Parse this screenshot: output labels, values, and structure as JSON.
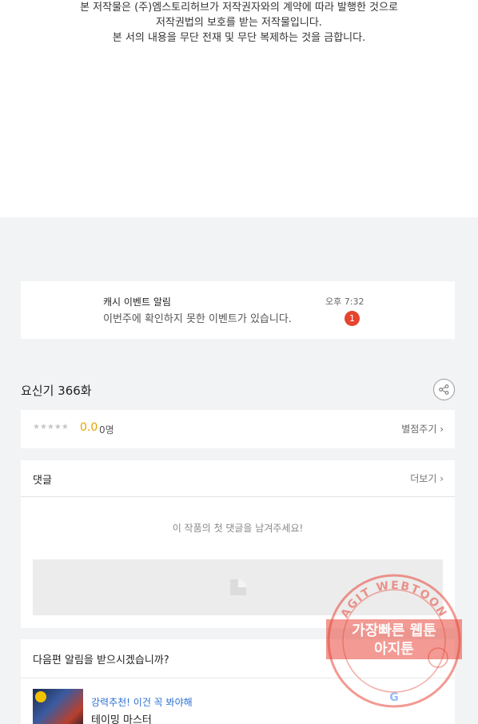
{
  "copyright": {
    "line1": "본 저작물은 (주)엠스토리허브가 저작권자와의 계약에 따라 발행한 것으로",
    "line2": "저작권법의 보호를 받는 저작물입니다.",
    "line3": "본 서의 내용을 무단 전재 및 무단 복제하는 것을 금합니다."
  },
  "notice": {
    "title": "캐시 이벤트 알림",
    "body": "이번주에 확인하지 못한 이벤트가 있습니다.",
    "time": "오후 7:32",
    "badge": "1"
  },
  "episode": {
    "title": "요신기 366화",
    "share_icon": "share-icon"
  },
  "rating": {
    "stars": "★★★★★",
    "score": "0.0",
    "count": "0명",
    "rate_label": "별점주기 ›"
  },
  "comments": {
    "title": "댓글",
    "more_label": "더보기 ›",
    "empty_text": "이 작품의 첫 댓글을 남겨주세요!"
  },
  "next_alert": {
    "title": "다음편 알림을 받으시겠습니까?",
    "rec_label": "강력추천! 이건 꼭 봐야해",
    "rec_title": "테이밍 마스터"
  },
  "watermark": {
    "arc_text": "AGIT WEBTOON",
    "line1": "가장빠른 웹툰",
    "line2": "아지툰"
  },
  "colors": {
    "badge": "#e5442f",
    "score": "#e6a100",
    "rec_label": "#2c6fd1",
    "watermark": "#e8473a"
  }
}
